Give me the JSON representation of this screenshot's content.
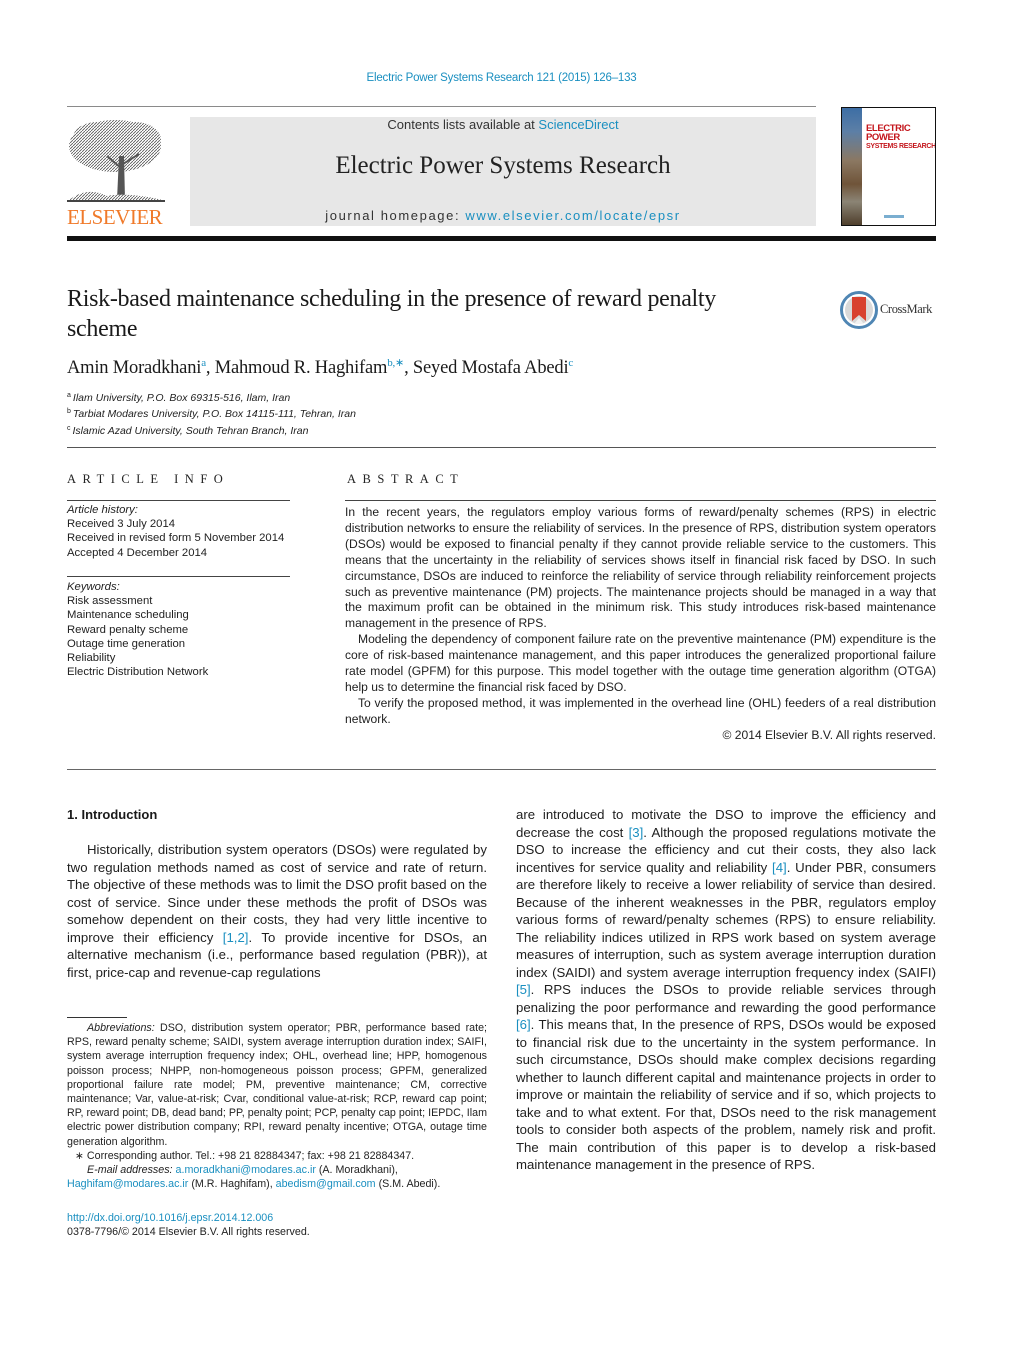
{
  "header": {
    "running_head": "Electric Power Systems Research 121 (2015) 126–133",
    "contents_prefix": "Contents lists available at ",
    "contents_link": "ScienceDirect",
    "journal_title": "Electric Power Systems Research",
    "homepage_prefix": "journal homepage: ",
    "homepage_link": "www.elsevier.com/locate/epsr",
    "publisher": "ELSEVIER",
    "cover_title_line1": "ELECTRIC POWER",
    "cover_title_line2": "SYSTEMS RESEARCH"
  },
  "colors": {
    "link": "#1a8fc0",
    "elsevier_orange": "#f07a2a",
    "cover_red": "#c4161c",
    "banner_gray": "#e7e7e7"
  },
  "article": {
    "title": "Risk-based maintenance scheduling in the presence of reward penalty scheme",
    "crossmark_label": "CrossMark",
    "authors": [
      {
        "name": "Amin Moradkhani",
        "sup": "a"
      },
      {
        "name": "Mahmoud R. Haghifam",
        "sup": "b,∗"
      },
      {
        "name": "Seyed Mostafa Abedi",
        "sup": "c"
      }
    ],
    "affiliations": [
      {
        "sup": "a",
        "text": "Ilam University, P.O. Box 69315-516, Ilam, Iran"
      },
      {
        "sup": "b",
        "text": "Tarbiat Modares University, P.O. Box 14115-111, Tehran, Iran"
      },
      {
        "sup": "c",
        "text": "Islamic Azad University, South Tehran Branch, Iran"
      }
    ]
  },
  "article_info": {
    "heading": "ARTICLE INFO",
    "history_label": "Article history:",
    "history": [
      "Received 3 July 2014",
      "Received in revised form 5 November 2014",
      "Accepted 4 December 2014"
    ],
    "keywords_label": "Keywords:",
    "keywords": [
      "Risk assessment",
      "Maintenance scheduling",
      "Reward penalty scheme",
      "Outage time generation",
      "Reliability",
      "Electric Distribution Network"
    ]
  },
  "abstract": {
    "heading": "ABSTRACT",
    "paragraphs": [
      "In the recent years, the regulators employ various forms of reward/penalty schemes (RPS) in electric distribution networks to ensure the reliability of services. In the presence of RPS, distribution system operators (DSOs) would be exposed to financial penalty if they cannot provide reliable service to the customers. This means that the uncertainty in the reliability of services shows itself in financial risk faced by DSO. In such circumstance, DSOs are induced to reinforce the reliability of service through reliability reinforcement projects such as preventive maintenance (PM) projects. The maintenance projects should be managed in a way that the maximum profit can be obtained in the minimum risk. This study introduces risk-based maintenance management in the presence of RPS.",
      "Modeling the dependency of component failure rate on the preventive maintenance (PM) expenditure is the core of risk-based maintenance management, and this paper introduces the generalized proportional failure rate model (GPFM) for this purpose. This model together with the outage time generation algorithm (OTGA) help us to determine the financial risk faced by DSO.",
      "To verify the proposed method, it was implemented in the overhead line (OHL) feeders of a real distribution network."
    ],
    "copyright": "© 2014 Elsevier B.V. All rights reserved."
  },
  "introduction": {
    "heading": "1.  Introduction",
    "left_p1_a": "Historically, distribution system operators (DSOs) were regulated by two regulation methods named as cost of service and rate of return. The objective of these methods was to limit the DSO profit based on the cost of service. Since under these methods the profit of DSOs was somehow dependent on their costs, they had very little incentive to improve their efficiency ",
    "ref_1_2": "[1,2]",
    "left_p1_b": ". To provide incentive for DSOs, an alternative mechanism (i.e., performance based regulation (PBR)), at first, price-cap and revenue-cap regulations",
    "right_a": "are introduced to motivate the DSO to improve the efficiency and decrease the cost ",
    "ref_3": "[3]",
    "right_b": ". Although the proposed regulations motivate the DSO to increase the efficiency and cut their costs, they also lack incentives for service quality and reliability ",
    "ref_4": "[4]",
    "right_c": ". Under PBR, consumers are therefore likely to receive a lower reliability of service than desired. Because of the inherent weaknesses in the PBR, regulators employ various forms of reward/penalty schemes (RPS) to ensure reliability. The reliability indices utilized in RPS work based on system average measures of interruption, such as system average interruption duration index (SAIDI) and system average interruption frequency index (SAIFI) ",
    "ref_5": "[5]",
    "right_d": ". RPS induces the DSOs to provide reliable services through penalizing the poor performance and rewarding the good performance ",
    "ref_6": "[6]",
    "right_e": ". This means that, In the presence of RPS, DSOs would be exposed to financial risk due to the uncertainty in the system performance. In such circumstance, DSOs should make complex decisions regarding whether to launch different capital and maintenance projects in order to improve or maintain the reliability of service and if so, which projects to take and to what extent. For that, DSOs need to the risk management tools to consider both aspects of the problem, namely risk and profit. The main contribution of this paper is to develop a risk-based maintenance management in the presence of RPS."
  },
  "footnotes": {
    "abbrev_label": "Abbreviations:",
    "abbrev_text": "  DSO, distribution system operator; PBR, performance based rate; RPS, reward penalty scheme; SAIDI, system average interruption duration index; SAIFI, system average interruption frequency index; OHL, overhead line; HPP, homogenous poisson process; NHPP, non-homogeneous poisson process; GPFM, generalized proportional failure rate model; PM, preventive maintenance; CM, corrective maintenance; Var, value-at-risk; Cvar, conditional value-at-risk; RCP, reward cap point; RP, reward point; DB, dead band; PP, penalty point; PCP, penalty cap point; IEPDC, Ilam electric power distribution company; RPI, reward penalty incentive; OTGA, outage time generation algorithm.",
    "corresponding": "∗  Corresponding author. Tel.: +98 21 82884347; fax: +98 21 82884347.",
    "email_label": "E-mail addresses:",
    "emails": [
      {
        "address": "a.moradkhani@modares.ac.ir",
        "owner": " (A. Moradkhani),"
      },
      {
        "address": "Haghifam@modares.ac.ir",
        "owner": " (M.R. Haghifam), "
      },
      {
        "address": "abedism@gmail.com",
        "owner": " (S.M. Abedi)."
      }
    ]
  },
  "doi": {
    "link": "http://dx.doi.org/10.1016/j.epsr.2014.12.006",
    "issn_line": "0378-7796/© 2014 Elsevier B.V. All rights reserved."
  }
}
